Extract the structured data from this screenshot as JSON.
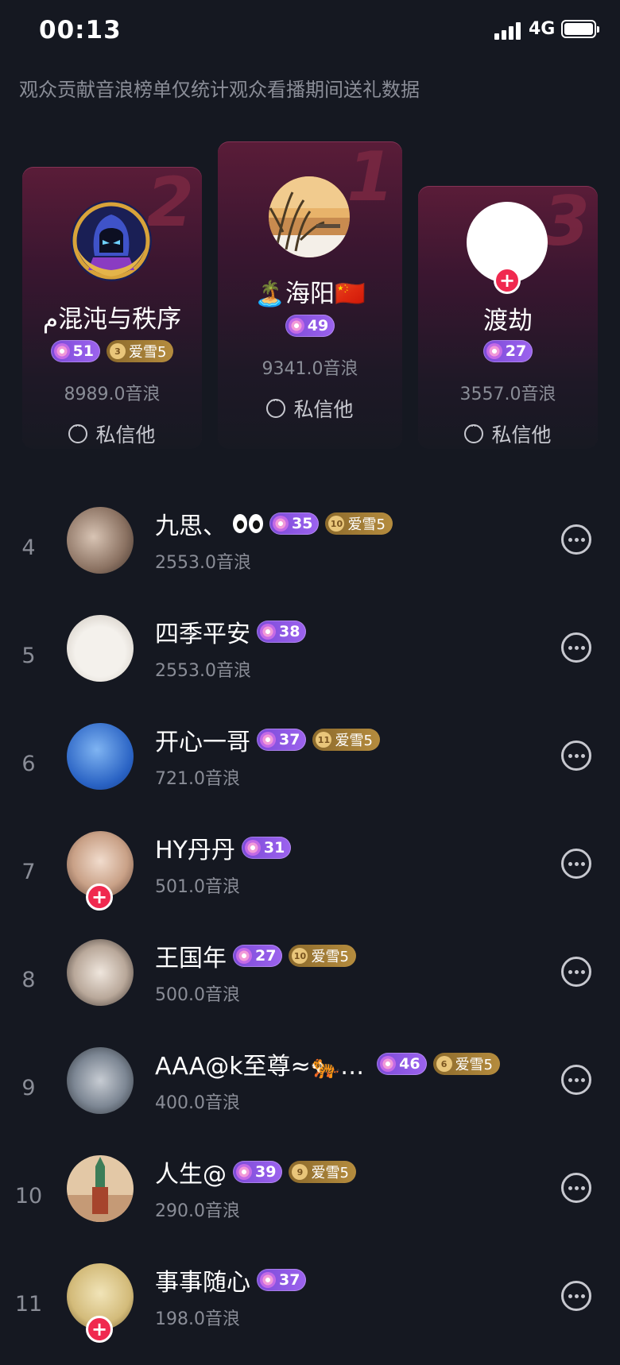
{
  "status_bar": {
    "time": "00:13",
    "network": "4G"
  },
  "notice": "观众贡献音浪榜单仅统计观众看播期间送礼数据",
  "podium": [
    {
      "rank": "2",
      "name": "م混沌与秩序",
      "level": "51",
      "fan_level": "3",
      "fan_name": "爱雪5",
      "score": "8989.0音浪",
      "message": "私信他",
      "avatar": "knight-avatar"
    },
    {
      "rank": "1",
      "name": "🏝️海阳🇨🇳",
      "level": "49",
      "score": "9341.0音浪",
      "message": "私信他",
      "avatar": "reeds-sunset-avatar"
    },
    {
      "rank": "3",
      "name": "渡劫",
      "level": "27",
      "score": "3557.0音浪",
      "message": "私信他",
      "avatar": "white-avatar",
      "follow": "+"
    }
  ],
  "list": [
    {
      "rank": "4",
      "name": "九思、",
      "emoji": "eyes",
      "level": "35",
      "fan_level": "10",
      "fan_name": "爱雪5",
      "score": "2553.0音浪"
    },
    {
      "rank": "5",
      "name": "四季平安",
      "level": "38",
      "score": "2553.0音浪"
    },
    {
      "rank": "6",
      "name": "开心一哥",
      "level": "37",
      "fan_level": "11",
      "fan_name": "爱雪5",
      "score": "721.0音浪"
    },
    {
      "rank": "7",
      "name": "HY丹丹",
      "level": "31",
      "score": "501.0音浪",
      "follow": "+"
    },
    {
      "rank": "8",
      "name": "王国年",
      "level": "27",
      "fan_level": "10",
      "fan_name": "爱雪5",
      "score": "500.0音浪"
    },
    {
      "rank": "9",
      "name": "AAA@k至尊≈🐅…",
      "level": "46",
      "fan_level": "6",
      "fan_name": "爱雪5",
      "score": "400.0音浪"
    },
    {
      "rank": "10",
      "name": "人生@",
      "level": "39",
      "fan_level": "9",
      "fan_name": "爱雪5",
      "score": "290.0音浪"
    },
    {
      "rank": "11",
      "name": "事事随心",
      "level": "37",
      "score": "198.0音浪",
      "follow": "+"
    }
  ],
  "colors": {
    "background": "#151821",
    "level_badge": "#8b57e4",
    "fan_badge": "#a37d36",
    "follow": "#f0294f"
  }
}
